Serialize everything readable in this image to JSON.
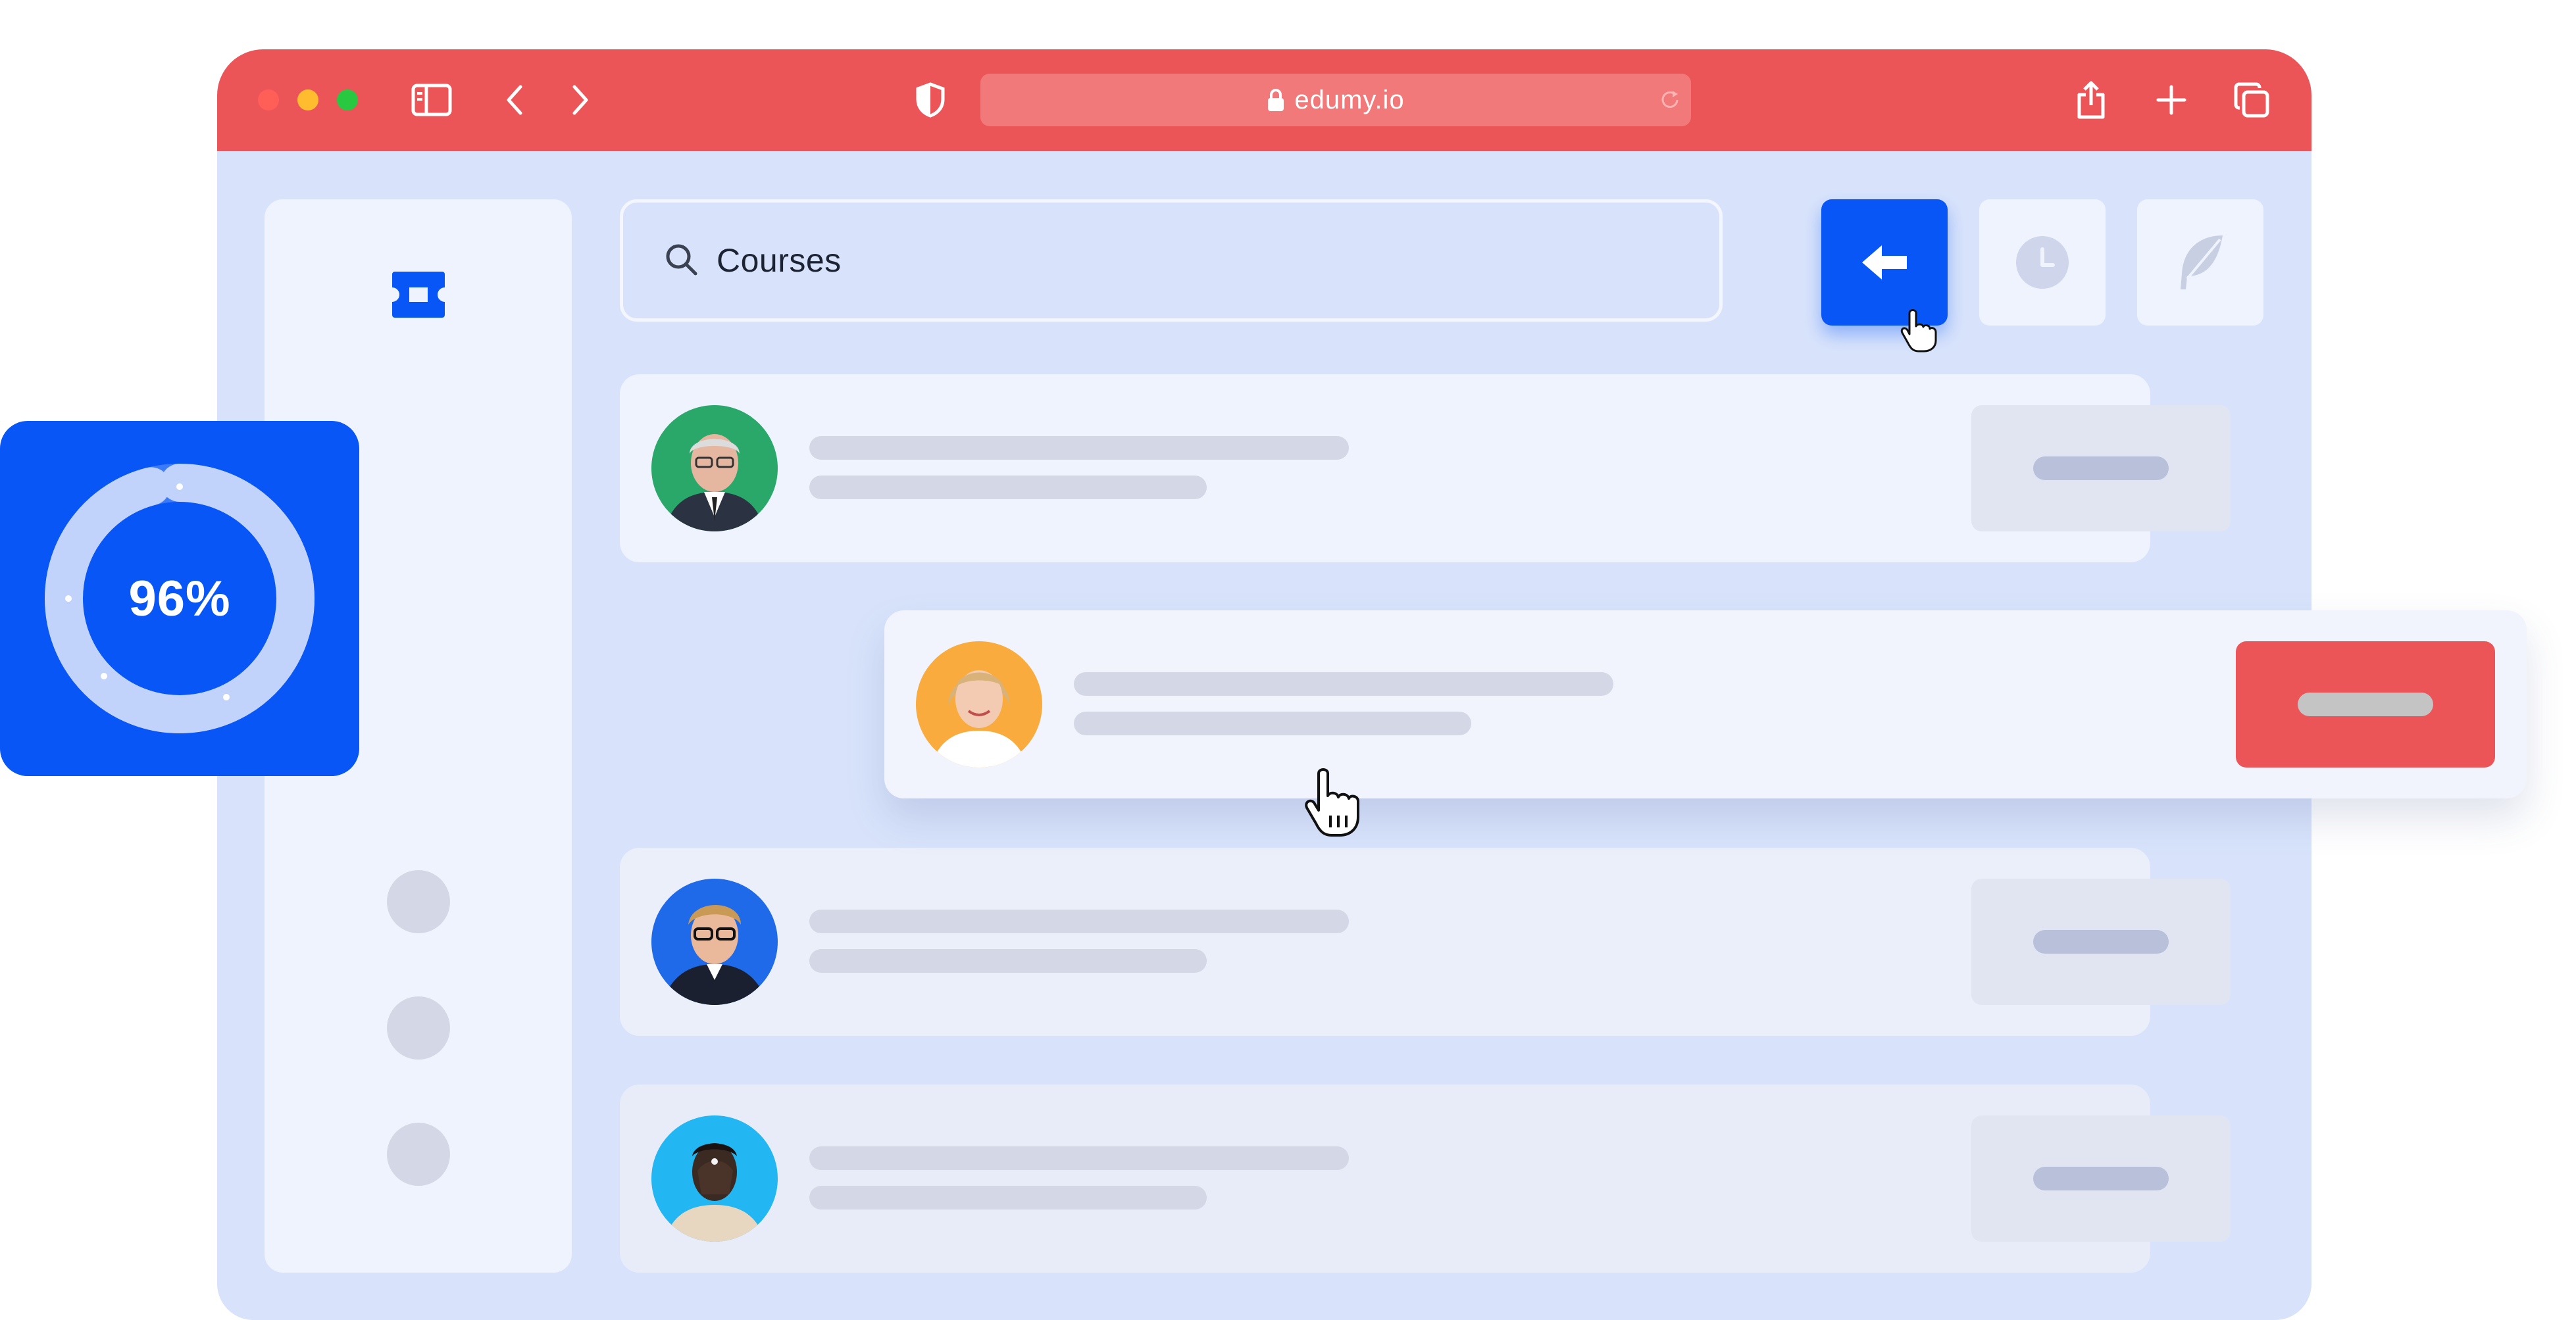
{
  "browser": {
    "url": "edumy.io",
    "titlebar_color": "#ec5557",
    "traffic_lights": [
      "#ff5f57",
      "#febc2e",
      "#28c840"
    ],
    "icons": [
      "sidebar-toggle-icon",
      "back-chevron-icon",
      "forward-chevron-icon",
      "shield-icon",
      "lock-icon",
      "reload-icon",
      "share-icon",
      "plus-icon",
      "tabs-icon"
    ]
  },
  "sidebar": {
    "logo_icon": "ticket-icon",
    "items": [
      "nav-dot-1",
      "nav-dot-2",
      "nav-dot-3"
    ]
  },
  "search": {
    "icon": "search-icon",
    "value": "Courses"
  },
  "toolbar": {
    "back_button_icon": "arrow-left-icon",
    "history_button_icon": "clock-icon",
    "feather_button_icon": "feather-icon",
    "accent": "#0756f5"
  },
  "list": {
    "rows": [
      {
        "avatar": "man-gray-hair-glasses",
        "avatar_bg": "#2aa86a",
        "state": "default"
      },
      {
        "avatar": "smiling-woman-blonde",
        "avatar_bg": "#f9ab3e",
        "state": "dragging",
        "button_color": "#ec5557"
      },
      {
        "avatar": "young-man-glasses",
        "avatar_bg": "#1f6ae8",
        "state": "default"
      },
      {
        "avatar": "man-hand-on-face",
        "avatar_bg": "#22b6f2",
        "state": "default"
      }
    ]
  },
  "progress_card": {
    "label": "96%",
    "value": 0.96,
    "bg": "#0756f5"
  }
}
